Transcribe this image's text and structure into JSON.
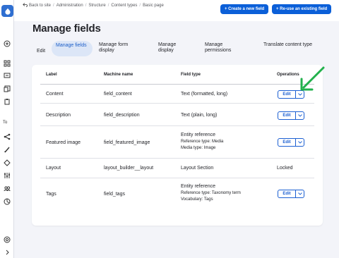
{
  "breadcrumb": {
    "items": [
      "Back to site",
      "Administration",
      "Structure",
      "Content types",
      "Basic page"
    ]
  },
  "actions": {
    "create": "+ Create a new field",
    "reuse": "+ Re-use an existing field"
  },
  "page": {
    "title": "Manage fields"
  },
  "tabs": [
    {
      "label": "Edit"
    },
    {
      "label": "Manage fields"
    },
    {
      "label": "Manage form display"
    },
    {
      "label": "Manage display"
    },
    {
      "label": "Manage permissions"
    },
    {
      "label": "Translate content type"
    }
  ],
  "sidebar": {
    "text": "To"
  },
  "table": {
    "headers": [
      "Label",
      "Machine name",
      "Field type",
      "Operations"
    ],
    "rows": [
      {
        "label": "Content",
        "machine": "field_content",
        "type": "Text (formatted, long)",
        "op": "Edit"
      },
      {
        "label": "Description",
        "machine": "field_description",
        "type": "Text (plain, long)",
        "op": "Edit"
      },
      {
        "label": "Featured image",
        "machine": "field_featured_image",
        "type": "Entity reference",
        "sub1": "Reference type: Media",
        "sub2": "Media type: Image",
        "op": "Edit"
      },
      {
        "label": "Layout",
        "machine": "layout_builder__layout",
        "type": "Layout Section",
        "op": "Locked"
      },
      {
        "label": "Tags",
        "machine": "field_tags",
        "type": "Entity reference",
        "sub1": "Reference type: Taxonomy term",
        "sub2": "Vocabulary: Tags",
        "op": "Edit"
      }
    ]
  },
  "colors": {
    "accent": "#0b5fd8",
    "tab_active_bg": "#dce6f7",
    "annotation": "#22b14c"
  },
  "icons": [
    "drupal-logo-icon",
    "plus-circle-icon",
    "grid-icon",
    "file-icon",
    "content-icon",
    "clipboard-icon",
    "structure-icon",
    "brush-icon",
    "extend-icon",
    "wrench-icon",
    "config-icon",
    "people-icon",
    "reports-icon",
    "help-icon",
    "chevron-right-icon"
  ]
}
